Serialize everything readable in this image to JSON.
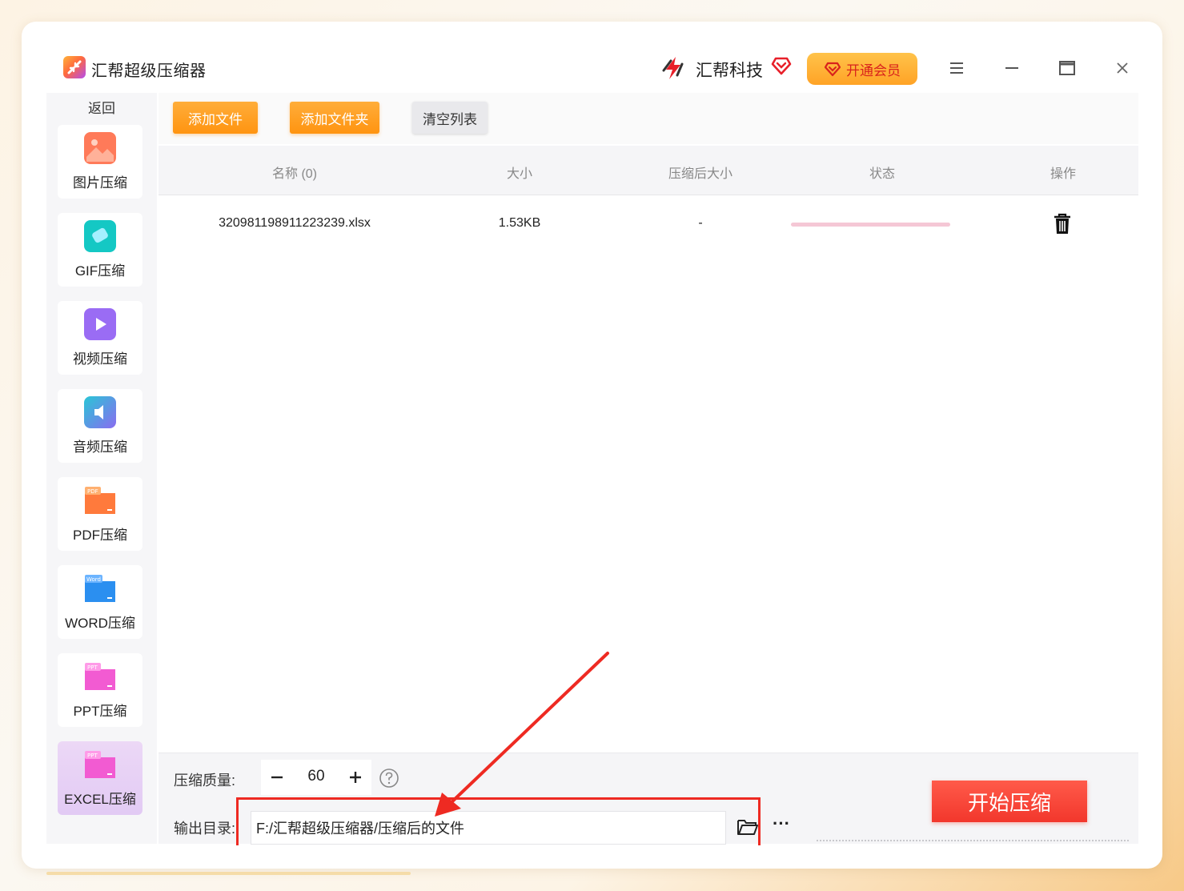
{
  "app": {
    "title": "汇帮超级压缩器",
    "brand_name": "汇帮科技",
    "vip_label": "开通会员"
  },
  "sidebar": {
    "back_label": "返回",
    "items": [
      {
        "label": "图片压缩",
        "icon": "image-icon"
      },
      {
        "label": "GIF压缩",
        "icon": "gif-icon"
      },
      {
        "label": "视频压缩",
        "icon": "video-icon"
      },
      {
        "label": "音频压缩",
        "icon": "audio-icon"
      },
      {
        "label": "PDF压缩",
        "icon": "pdf-icon",
        "badge": "PDF"
      },
      {
        "label": "WORD压缩",
        "icon": "word-icon",
        "badge": "Word"
      },
      {
        "label": "PPT压缩",
        "icon": "ppt-icon",
        "badge": "PPT"
      },
      {
        "label": "EXCEL压缩",
        "icon": "excel-icon",
        "badge": "PPT",
        "active": true
      }
    ]
  },
  "toolbar": {
    "add_file": "添加文件",
    "add_folder": "添加文件夹",
    "clear_list": "清空列表"
  },
  "table": {
    "columns": [
      "名称 (0)",
      "大小",
      "压缩后大小",
      "状态",
      "操作"
    ],
    "rows": [
      {
        "name": "320981198911223239.xlsx",
        "size": "1.53KB",
        "compressed_size": "-",
        "progress": 0
      }
    ]
  },
  "bottom": {
    "quality_label": "压缩质量:",
    "quality_value": "60",
    "output_label": "输出目录:",
    "output_path": "F:/汇帮超级压缩器/压缩后的文件",
    "more_label": "···",
    "start_label": "开始压缩"
  },
  "colors": {
    "accent_orange": "#ff9d1f",
    "start_red": "#f2372c",
    "annotation_red": "#ee2a22"
  }
}
